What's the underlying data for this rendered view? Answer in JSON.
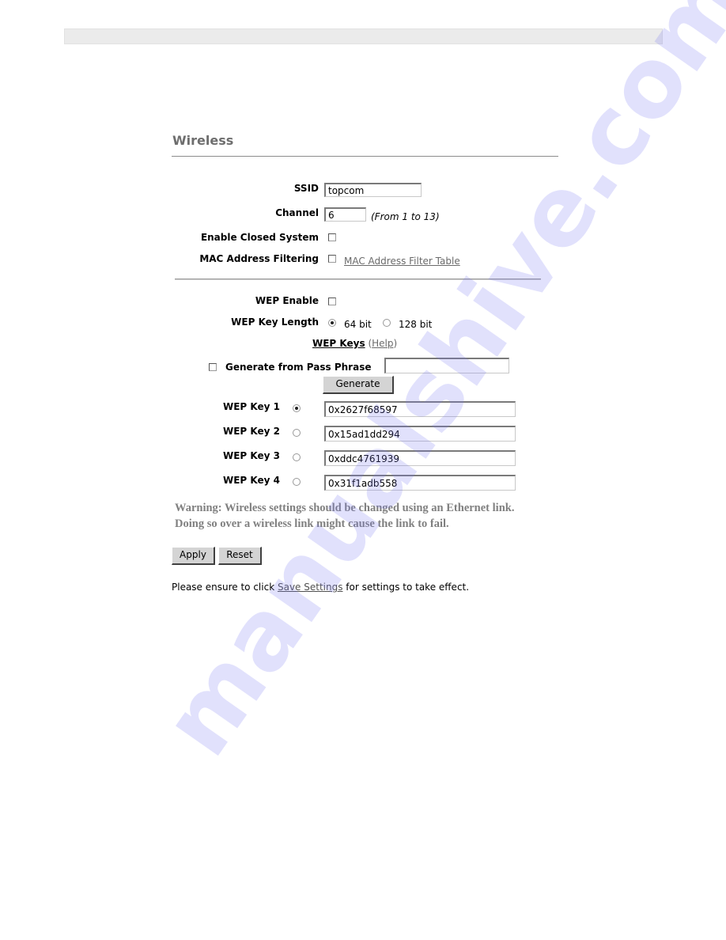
{
  "page": {
    "title": "Wireless",
    "fields": {
      "ssid": {
        "label": "SSID",
        "value": "topcom"
      },
      "channel": {
        "label": "Channel",
        "value": "6",
        "hint": "(From 1 to 13)"
      },
      "closed_system": {
        "label": "Enable Closed System",
        "checked": false
      },
      "mac_filtering": {
        "label": "MAC Address Filtering",
        "checked": false,
        "link": "MAC Address Filter Table"
      }
    },
    "wep": {
      "enable_label": "WEP Enable",
      "enable_checked": false,
      "key_length_label": "WEP Key Length",
      "key_length_options": [
        "64 bit",
        "128 bit"
      ],
      "key_length_selected": "64 bit",
      "keys_heading": "WEP Keys",
      "help_open": "(",
      "help_link": "Help",
      "help_close": ")",
      "pass_phrase_label": "Generate from Pass Phrase",
      "pass_phrase_checked": false,
      "pass_phrase_value": "",
      "generate_button": "Generate",
      "keys": [
        {
          "label": "WEP Key 1",
          "value": "0x2627f68597",
          "selected": true
        },
        {
          "label": "WEP Key 2",
          "value": "0x15ad1dd294",
          "selected": false
        },
        {
          "label": "WEP Key 3",
          "value": "0xddc4761939",
          "selected": false
        },
        {
          "label": "WEP Key 4",
          "value": "0x31f1adb558",
          "selected": false
        }
      ]
    },
    "warning_line1": "Warning: Wireless settings should be changed using an Ethernet link.",
    "warning_line2": "Doing so over a wireless link might cause the link to fail.",
    "apply_button": "Apply",
    "reset_button": "Reset",
    "note_prefix": "Please ensure to click ",
    "note_link": "Save Settings",
    "note_suffix": " for settings to take effect.",
    "watermark": "manualshive.com"
  }
}
